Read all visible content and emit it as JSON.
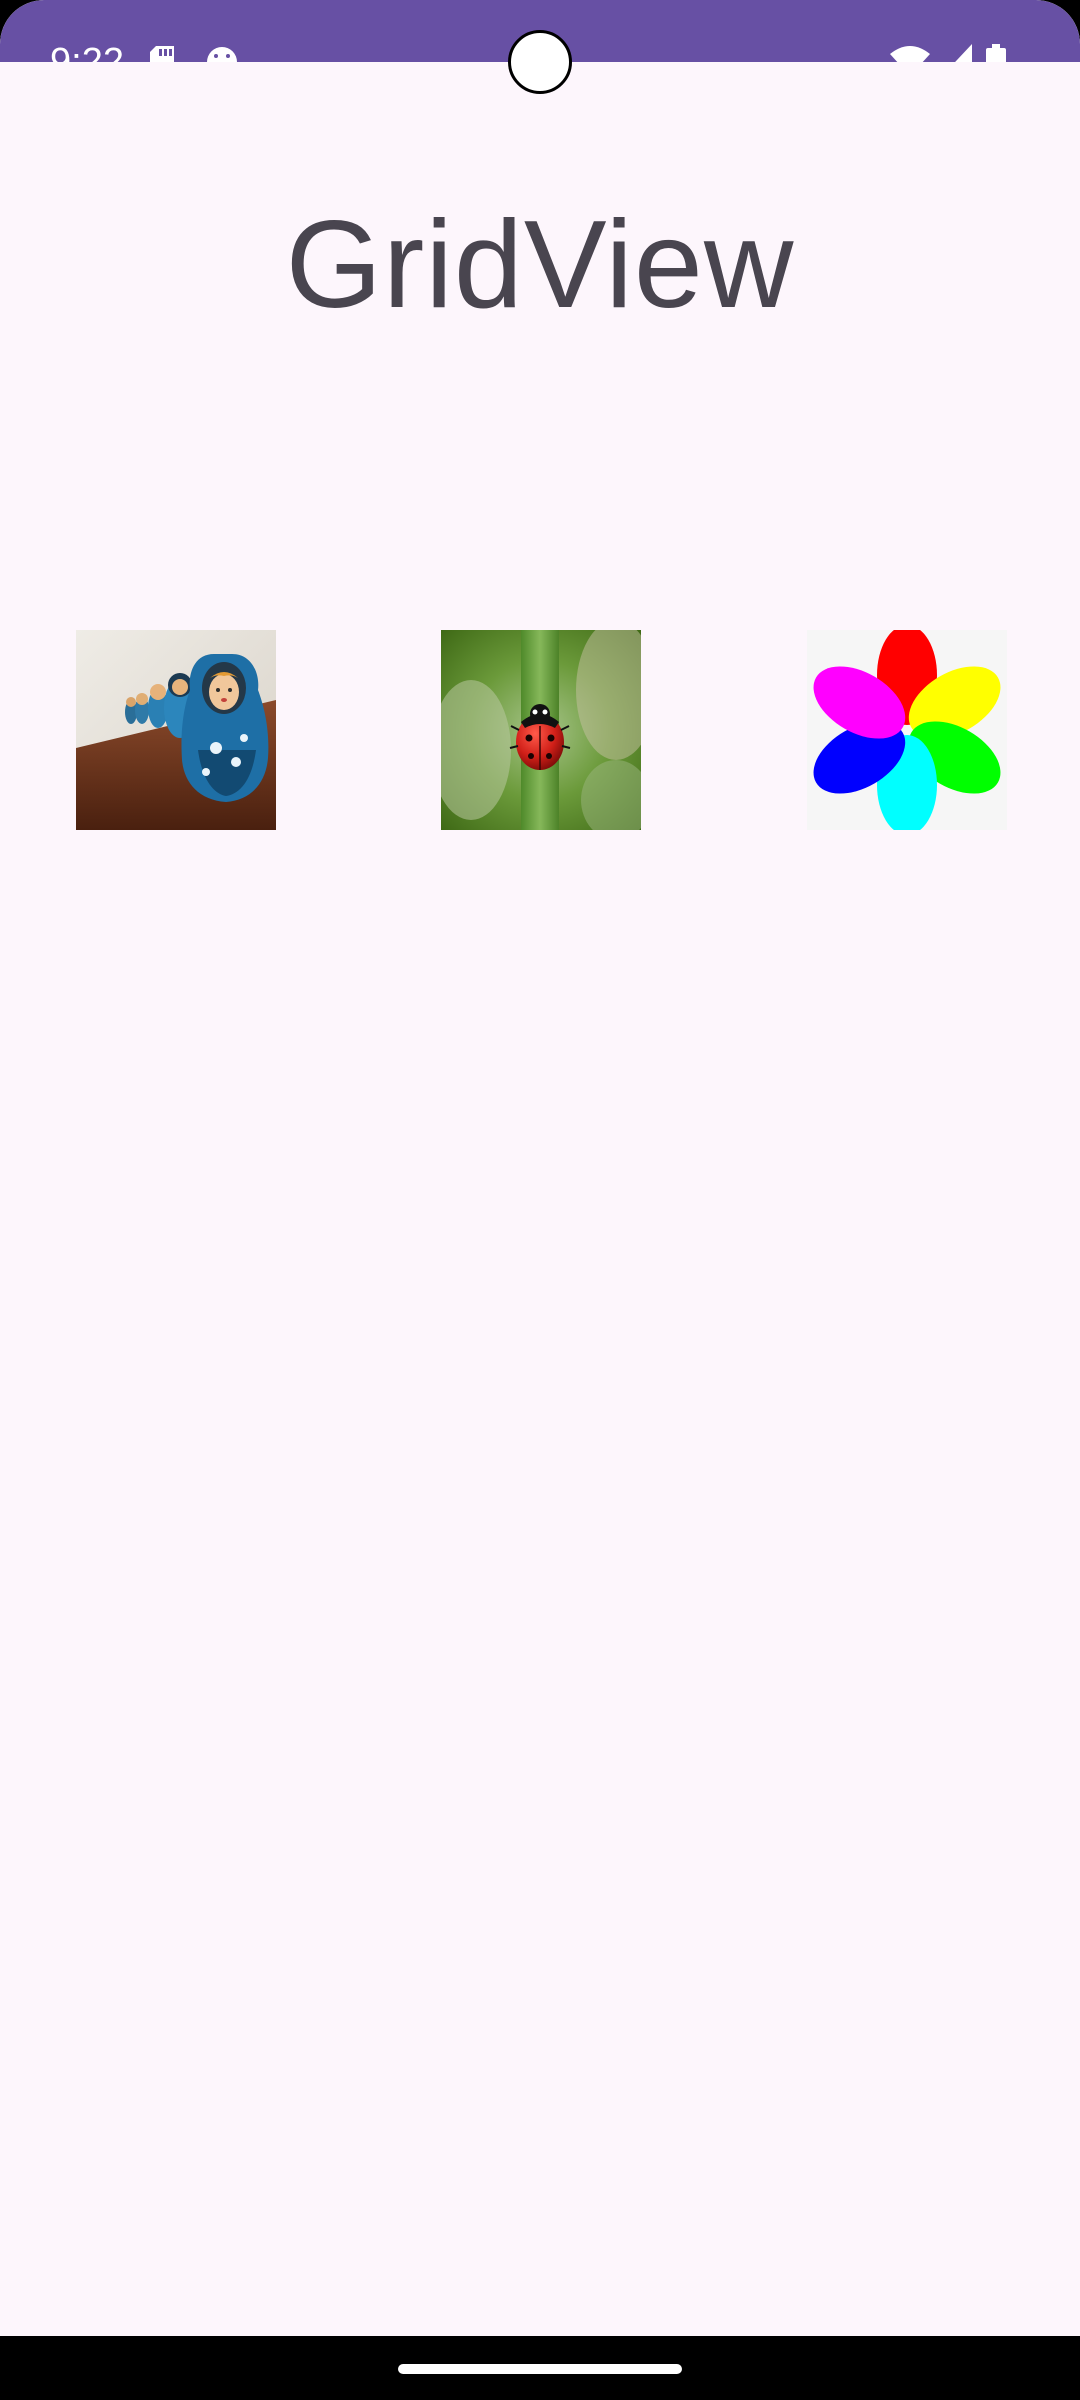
{
  "status_bar": {
    "time": "9:22",
    "icons": [
      "sd-card-icon",
      "android-debug-icon",
      "wifi-icon",
      "signal-icon",
      "battery-icon"
    ],
    "background_color": "#6750A4"
  },
  "app": {
    "title": "GridView",
    "background_color": "#FDF6FC",
    "title_color": "#49454F"
  },
  "grid": {
    "items": [
      {
        "name": "nesting-dolls-image"
      },
      {
        "name": "ladybug-image"
      },
      {
        "name": "pinwheel-image"
      }
    ]
  },
  "nav_bar": {
    "handle": "gesture-handle"
  }
}
